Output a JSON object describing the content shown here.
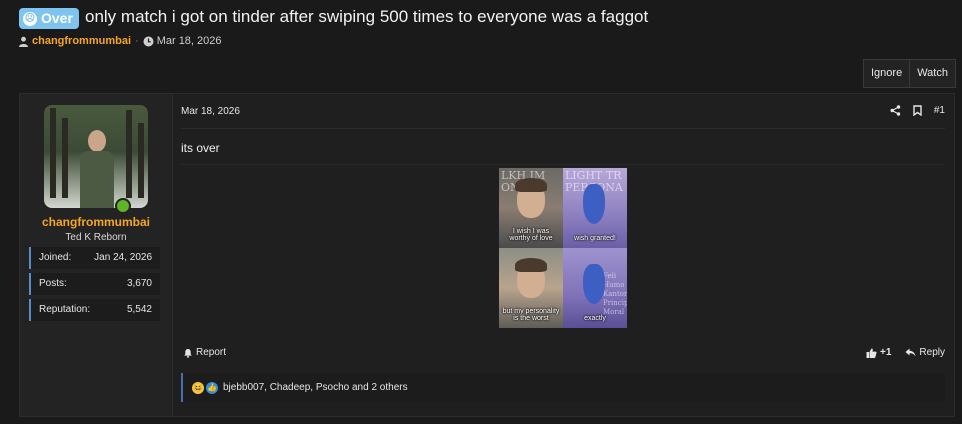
{
  "thread": {
    "prefix": "Over",
    "title": "only match i got on tinder after swiping 500 times to everyone was a faggot",
    "author": "changfrommumbai",
    "date": "Mar 18, 2026"
  },
  "actions": {
    "ignore": "Ignore",
    "watch": "Watch"
  },
  "user": {
    "username": "changfrommumbai",
    "title": "Ted K Reborn",
    "stats": [
      {
        "label": "Joined:",
        "value": "Jan 24, 2026"
      },
      {
        "label": "Posts:",
        "value": "3,670"
      },
      {
        "label": "Reputation:",
        "value": "5,542"
      }
    ]
  },
  "post": {
    "date": "Mar 18, 2026",
    "number": "#1",
    "text": "its over",
    "report": "Report",
    "plus_one": "+1",
    "reply": "Reply",
    "reactions_text": "bjebb007, Chadeep, Psocho and 2 others"
  },
  "meme": {
    "panels": [
      {
        "bg_text": "LKH IM\nONLI",
        "caption": "I wish I was\nworthy of love"
      },
      {
        "bg_text": "LIGHT TR\nPERSONA",
        "caption": "wish granted!"
      },
      {
        "bg_text": "",
        "caption": "but my personality\nis the worst"
      },
      {
        "bg_text": "Feli\nHumo\nKantor\nPrinciple\nMoral",
        "caption": "exactly"
      }
    ]
  },
  "colors": {
    "accent_username": "#f5a623",
    "prefix_badge": "#7fc4ee",
    "online": "#5fb526",
    "stat_border": "#5a8bcb"
  },
  "icons": {
    "user": "user-icon",
    "clock": "clock-icon",
    "share": "share-icon",
    "bookmark": "bookmark-icon",
    "bell": "bell-icon",
    "thumbs_up": "thumbs-up-icon",
    "reply": "reply-icon"
  }
}
